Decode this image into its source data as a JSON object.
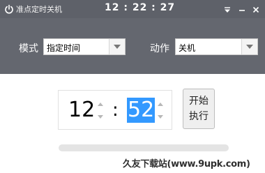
{
  "titlebar": {
    "app_title": "准点定时关机",
    "clock": "12 : 22 : 27",
    "icons": {
      "power": "power-icon",
      "menu": "menu-icon",
      "minimize": "minimize-icon",
      "close": "close-icon"
    }
  },
  "settings": {
    "mode_label": "模式",
    "mode_value": "指定时间",
    "action_label": "动作",
    "action_value": "关机"
  },
  "timer": {
    "hour": "12",
    "separator": ":",
    "minute": "52"
  },
  "execute_button": {
    "label": "开始执行"
  },
  "progress": {
    "value": 0
  },
  "watermark": {
    "text": "久友下载站(www.9upk.com)"
  },
  "colors": {
    "titlebar": "#5e6169",
    "settings_panel": "#64676f",
    "selection": "#3399ff"
  }
}
